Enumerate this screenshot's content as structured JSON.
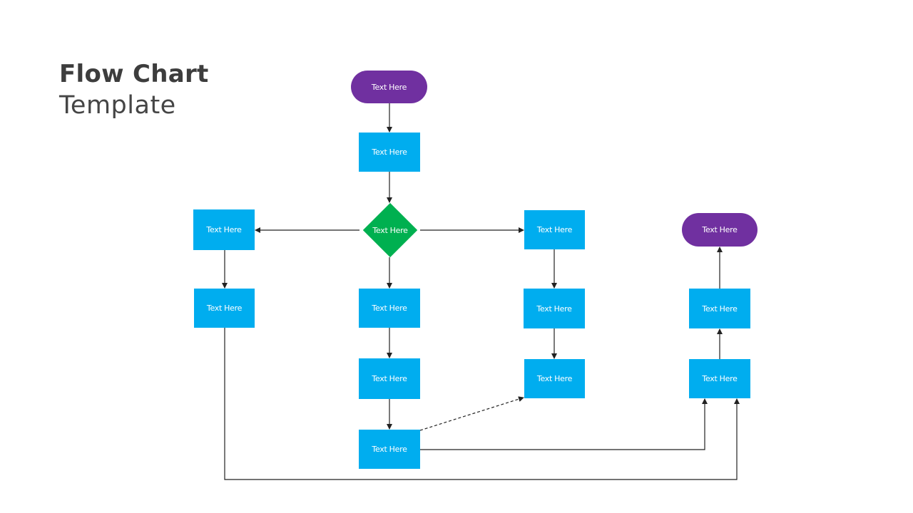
{
  "title": {
    "bold": "Flow Chart",
    "light": "Template"
  },
  "colors": {
    "process": "#00adef",
    "terminator": "#7030a0",
    "decision": "#00b050",
    "connector": "#222222"
  },
  "nodes": {
    "start": {
      "type": "terminator",
      "label": "Text Here"
    },
    "p1": {
      "type": "process",
      "label": "Text Here"
    },
    "decision": {
      "type": "decision",
      "label": "Text Here"
    },
    "left1": {
      "type": "process",
      "label": "Text Here"
    },
    "left2": {
      "type": "process",
      "label": "Text Here"
    },
    "mid1": {
      "type": "process",
      "label": "Text Here"
    },
    "mid2": {
      "type": "process",
      "label": "Text Here"
    },
    "mid3": {
      "type": "process",
      "label": "Text Here"
    },
    "right1": {
      "type": "process",
      "label": "Text Here"
    },
    "right2": {
      "type": "process",
      "label": "Text Here"
    },
    "right3": {
      "type": "process",
      "label": "Text Here"
    },
    "far1": {
      "type": "process",
      "label": "Text Here"
    },
    "far2": {
      "type": "process",
      "label": "Text Here"
    },
    "end": {
      "type": "terminator",
      "label": "Text Here"
    }
  },
  "edges": [
    {
      "from": "start",
      "to": "p1",
      "style": "solid"
    },
    {
      "from": "p1",
      "to": "decision",
      "style": "solid"
    },
    {
      "from": "decision",
      "to": "left1",
      "style": "solid"
    },
    {
      "from": "decision",
      "to": "right1",
      "style": "solid"
    },
    {
      "from": "decision",
      "to": "mid1",
      "style": "solid"
    },
    {
      "from": "left1",
      "to": "left2",
      "style": "solid"
    },
    {
      "from": "mid1",
      "to": "mid2",
      "style": "solid"
    },
    {
      "from": "mid2",
      "to": "mid3",
      "style": "solid"
    },
    {
      "from": "right1",
      "to": "right2",
      "style": "solid"
    },
    {
      "from": "right2",
      "to": "right3",
      "style": "solid"
    },
    {
      "from": "mid3",
      "to": "right3",
      "style": "dashed"
    },
    {
      "from": "mid3",
      "to": "far1",
      "style": "solid"
    },
    {
      "from": "left2",
      "to": "far1",
      "style": "solid"
    },
    {
      "from": "far1",
      "to": "far2",
      "style": "solid"
    },
    {
      "from": "far2",
      "to": "end",
      "style": "solid"
    }
  ]
}
